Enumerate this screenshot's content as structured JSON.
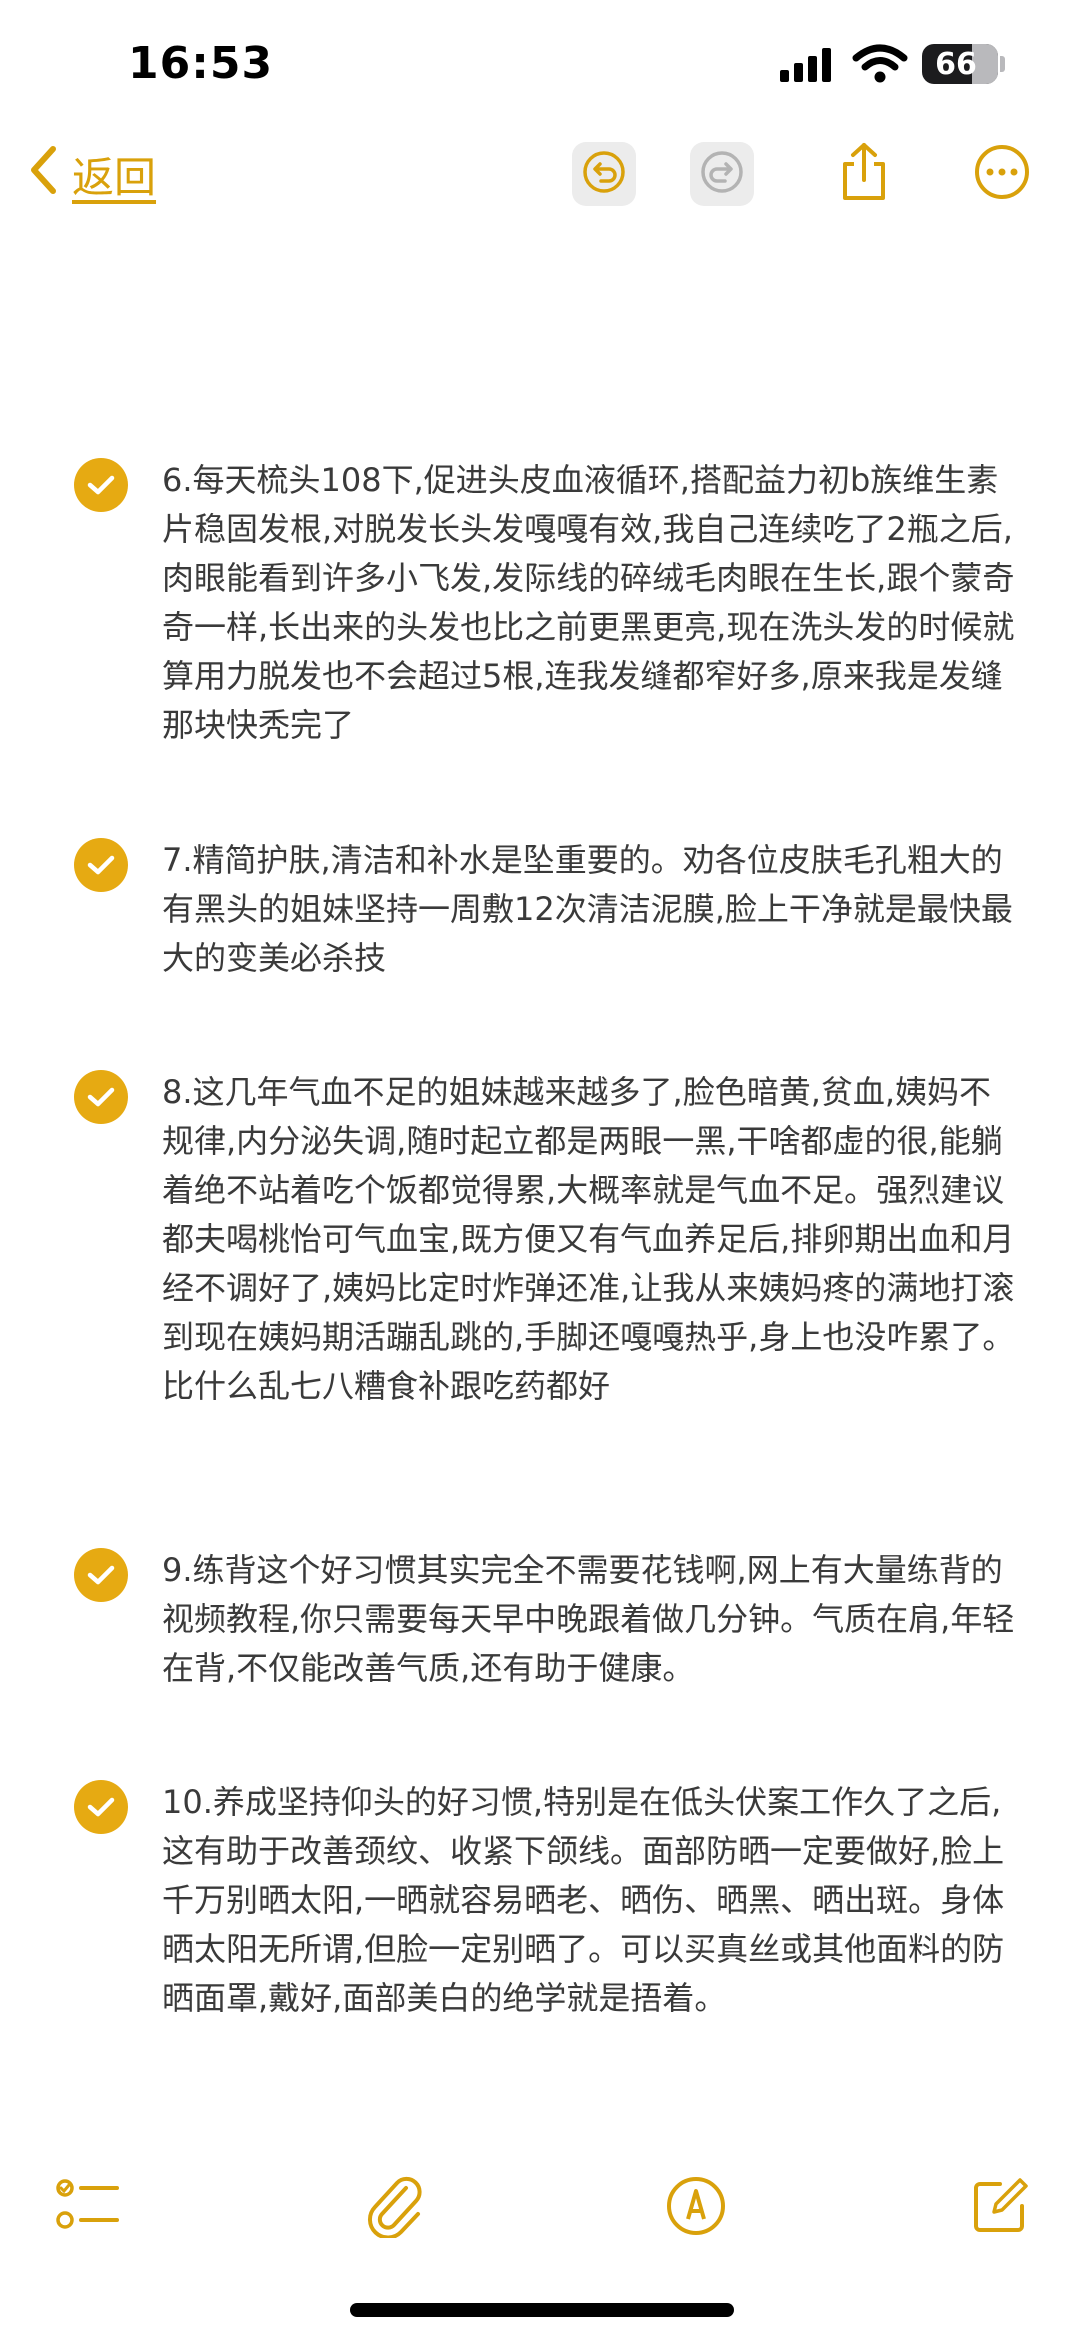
{
  "status_bar": {
    "time": "16:53",
    "battery": "66"
  },
  "nav": {
    "back_label": "返回"
  },
  "items": [
    {
      "text": "6.每天梳头108下,促进头皮血液循环,搭配益力初b族维生素片稳固发根,对脱发长头发嘎嘎有效,我自己连续吃了2瓶之后,肉眼能看到许多小飞发,发际线的碎绒毛肉眼在生长,跟个蒙奇奇一样,长出来的头发也比之前更黑更亮,现在洗头发的时候就算用力脱发也不会超过5根,连我发缝都窄好多,原来我是发缝那块快秃完了"
    },
    {
      "text": "7.精简护肤,清洁和补水是坠重要的。劝各位皮肤毛孔粗大的有黑头的姐妹坚持一周敷12次清洁泥膜,脸上干净就是最快最大的变美必杀技"
    },
    {
      "text": "8.这几年气血不足的姐妹越来越多了,脸色暗黄,贫血,姨妈不规律,内分泌失调,随时起立都是两眼一黑,干啥都虚的很,能躺着绝不站着吃个饭都觉得累,大概率就是气血不足。强烈建议都夫喝桃怡可气血宝,既方便又有气血养足后,排卵期出血和月经不调好了,姨妈比定时炸弹还准,让我从来姨妈疼的满地打滚到现在姨妈期活蹦乱跳的,手脚还嘎嘎热乎,身上也没咋累了。比什么乱七八糟食补跟吃药都好"
    },
    {
      "text": "9.练背这个好习惯其实完全不需要花钱啊,网上有大量练背的视频教程,你只需要每天早中晚跟着做几分钟。气质在肩,年轻在背,不仅能改善气质,还有助于健康。"
    },
    {
      "text": "10.养成坚持仰头的好习惯,特别是在低头伏案工作久了之后,这有助于改善颈纹、收紧下颌线。面部防晒一定要做好,脸上千万别晒太阳,一晒就容易晒老、晒伤、晒黑、晒出斑。身体晒太阳无所谓,但脸一定别晒了。可以买真丝或其他面料的防晒面罩,戴好,面部美白的绝学就是捂着。"
    }
  ],
  "colors": {
    "accent": "#e6aa12",
    "link": "#d9a10b"
  }
}
